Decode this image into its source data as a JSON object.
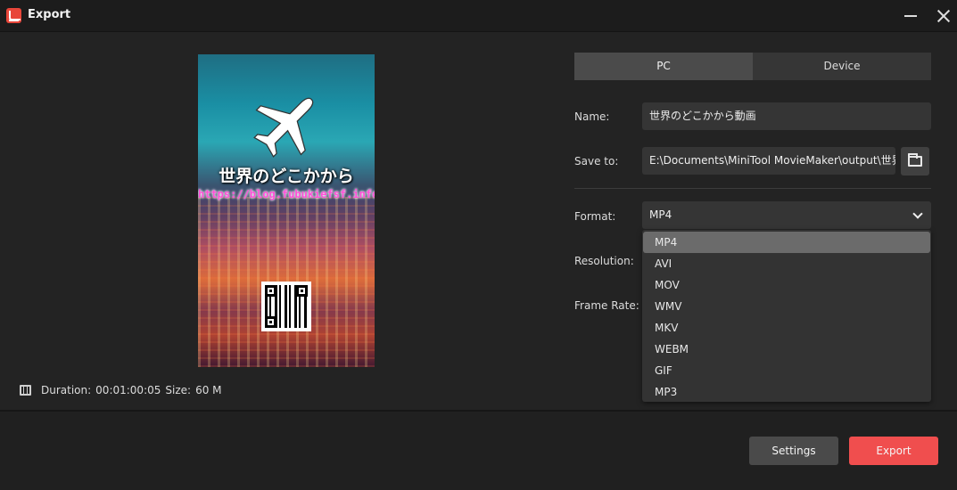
{
  "window": {
    "title": "Export"
  },
  "preview": {
    "title_text": "世界のどこかから",
    "url_text": "https://blog.fubukiefsf.info"
  },
  "info": {
    "duration_label": "Duration:",
    "duration_value": "00:01:00:05",
    "size_label": "Size:",
    "size_value": "60 M"
  },
  "tabs": [
    {
      "label": "PC",
      "active": true
    },
    {
      "label": "Device",
      "active": false
    }
  ],
  "form": {
    "name_label": "Name:",
    "name_value": "世界のどこかから動画",
    "save_label": "Save to:",
    "save_value": "E:\\Documents\\MiniTool MovieMaker\\output\\世界のど",
    "format_label": "Format:",
    "format_value": "MP4",
    "resolution_label": "Resolution:",
    "frame_rate_label": "Frame Rate:"
  },
  "format_options": [
    "MP4",
    "AVI",
    "MOV",
    "WMV",
    "MKV",
    "WEBM",
    "GIF",
    "MP3"
  ],
  "buttons": {
    "settings": "Settings",
    "export": "Export"
  },
  "colors": {
    "accent": "#f04e4e",
    "background": "#232323"
  }
}
